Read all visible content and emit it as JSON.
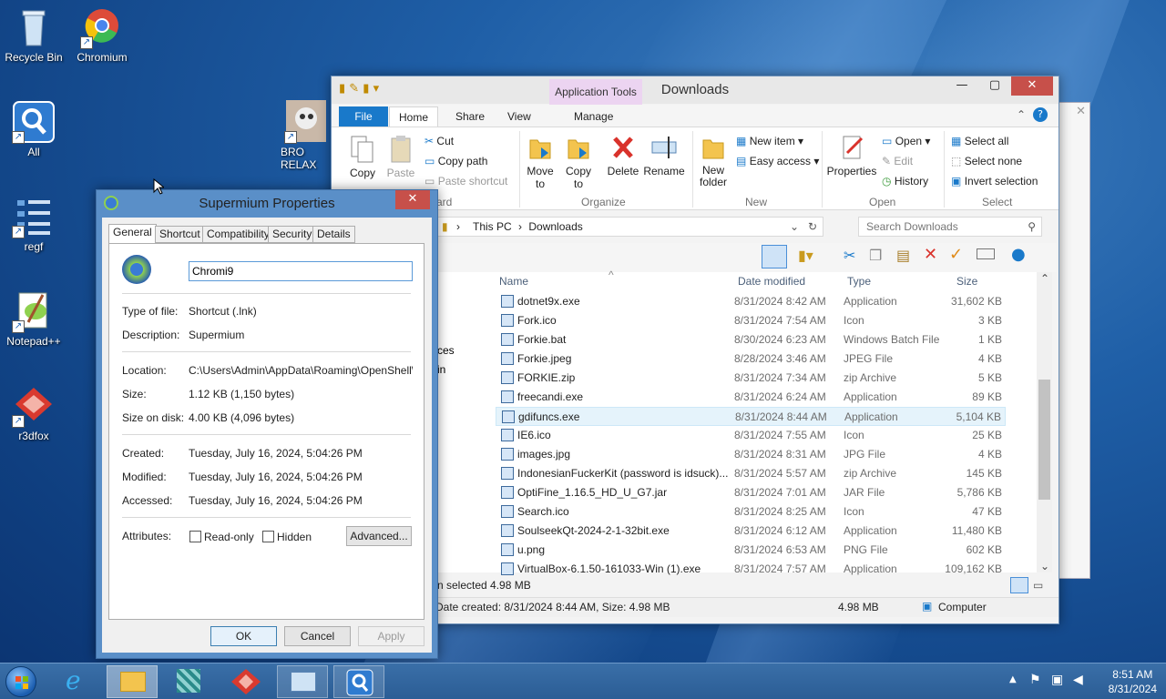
{
  "desktop": {
    "icons": [
      {
        "label": "Recycle Bin"
      },
      {
        "label": "Chromium"
      },
      {
        "label": "All"
      },
      {
        "label": "BRO RELAX"
      },
      {
        "label": "regf"
      },
      {
        "label": "Notepad++"
      },
      {
        "label": "r3dfox"
      }
    ]
  },
  "explorer": {
    "title": "Downloads",
    "app_tools": "Application Tools",
    "tabs": {
      "file": "File",
      "home": "Home",
      "share": "Share",
      "view": "View",
      "manage": "Manage"
    },
    "ribbon": {
      "copy": "Copy",
      "paste": "Paste",
      "cut": "Cut",
      "copy_path": "Copy path",
      "paste_shortcut": "Paste shortcut",
      "clipboard_label": "ard",
      "move_to": "Move to",
      "copy_to": "Copy to",
      "delete": "Delete",
      "rename": "Rename",
      "organize_label": "Organize",
      "new_folder": "New folder",
      "new_item": "New item",
      "easy_access": "Easy access",
      "new_label": "New",
      "properties": "Properties",
      "open": "Open",
      "edit": "Edit",
      "history": "History",
      "open_label": "Open",
      "select_all": "Select all",
      "select_none": "Select none",
      "invert_selection": "Invert selection",
      "select_label": "Select"
    },
    "address": {
      "this_pc": "This PC",
      "sep": "›",
      "folder": "Downloads"
    },
    "search_placeholder": "Search Downloads",
    "columns": {
      "name": "Name",
      "date": "Date modified",
      "type": "Type",
      "size": "Size"
    },
    "files": [
      {
        "name": "dotnet9x.exe",
        "date": "8/31/2024 8:42 AM",
        "type": "Application",
        "size": "31,602 KB"
      },
      {
        "name": "Fork.ico",
        "date": "8/31/2024 7:54 AM",
        "type": "Icon",
        "size": "3 KB"
      },
      {
        "name": "Forkie.bat",
        "date": "8/30/2024 6:23 AM",
        "type": "Windows Batch File",
        "size": "1 KB"
      },
      {
        "name": "Forkie.jpeg",
        "date": "8/28/2024 3:46 AM",
        "type": "JPEG File",
        "size": "4 KB"
      },
      {
        "name": "FORKIE.zip",
        "date": "8/31/2024 7:34 AM",
        "type": "zip Archive",
        "size": "5 KB"
      },
      {
        "name": "freecandi.exe",
        "date": "8/31/2024 6:24 AM",
        "type": "Application",
        "size": "89 KB"
      },
      {
        "name": "gdifuncs.exe",
        "date": "8/31/2024 8:44 AM",
        "type": "Application",
        "size": "5,104 KB"
      },
      {
        "name": "IE6.ico",
        "date": "8/31/2024 7:55 AM",
        "type": "Icon",
        "size": "25 KB"
      },
      {
        "name": "images.jpg",
        "date": "8/31/2024 8:31 AM",
        "type": "JPG File",
        "size": "4 KB"
      },
      {
        "name": "IndonesianFuckerKit (password is idsuck)...",
        "date": "8/31/2024 5:57 AM",
        "type": "zip Archive",
        "size": "145 KB"
      },
      {
        "name": "OptiFine_1.16.5_HD_U_G7.jar",
        "date": "8/31/2024 7:01 AM",
        "type": "JAR File",
        "size": "5,786 KB"
      },
      {
        "name": "Search.ico",
        "date": "8/31/2024 8:25 AM",
        "type": "Icon",
        "size": "47 KB"
      },
      {
        "name": "SoulseekQt-2024-2-1-32bit.exe",
        "date": "8/31/2024 6:12 AM",
        "type": "Application",
        "size": "11,480 KB"
      },
      {
        "name": "u.png",
        "date": "8/31/2024 6:53 AM",
        "type": "PNG File",
        "size": "602 KB"
      },
      {
        "name": "VirtualBox-6.1.50-161033-Win (1).exe",
        "date": "8/31/2024 7:57 AM",
        "type": "Application",
        "size": "109,162 KB"
      }
    ],
    "nav_fragments": {
      "a": "ces",
      "b": "in"
    },
    "status_selected": "n selected  4.98 MB",
    "details_bar": {
      "created": "Date created: 8/31/2024 8:44 AM, Size: 4.98 MB",
      "size": "4.98 MB",
      "location": "Computer"
    }
  },
  "properties": {
    "title": "Supermium Properties",
    "tabs": [
      "General",
      "Shortcut",
      "Compatibility",
      "Security",
      "Details"
    ],
    "name_value": "Chromi9",
    "fields": {
      "type_label": "Type of file:",
      "type_value": "Shortcut (.lnk)",
      "desc_label": "Description:",
      "desc_value": "Supermium",
      "loc_label": "Location:",
      "loc_value": "C:\\Users\\Admin\\AppData\\Roaming\\OpenShell\\Pinn",
      "size_label": "Size:",
      "size_value": "1.12 KB (1,150 bytes)",
      "disk_label": "Size on disk:",
      "disk_value": "4.00 KB (4,096 bytes)",
      "created_label": "Created:",
      "created_value": "Tuesday, July 16, 2024, 5:04:26 PM",
      "modified_label": "Modified:",
      "modified_value": "Tuesday, July 16, 2024, 5:04:26 PM",
      "accessed_label": "Accessed:",
      "accessed_value": "Tuesday, July 16, 2024, 5:04:26 PM",
      "attr_label": "Attributes:",
      "readonly": "Read-only",
      "hidden": "Hidden",
      "advanced": "Advanced..."
    },
    "buttons": {
      "ok": "OK",
      "cancel": "Cancel",
      "apply": "Apply"
    }
  },
  "taskbar": {
    "time": "8:51 AM",
    "date": "8/31/2024"
  }
}
